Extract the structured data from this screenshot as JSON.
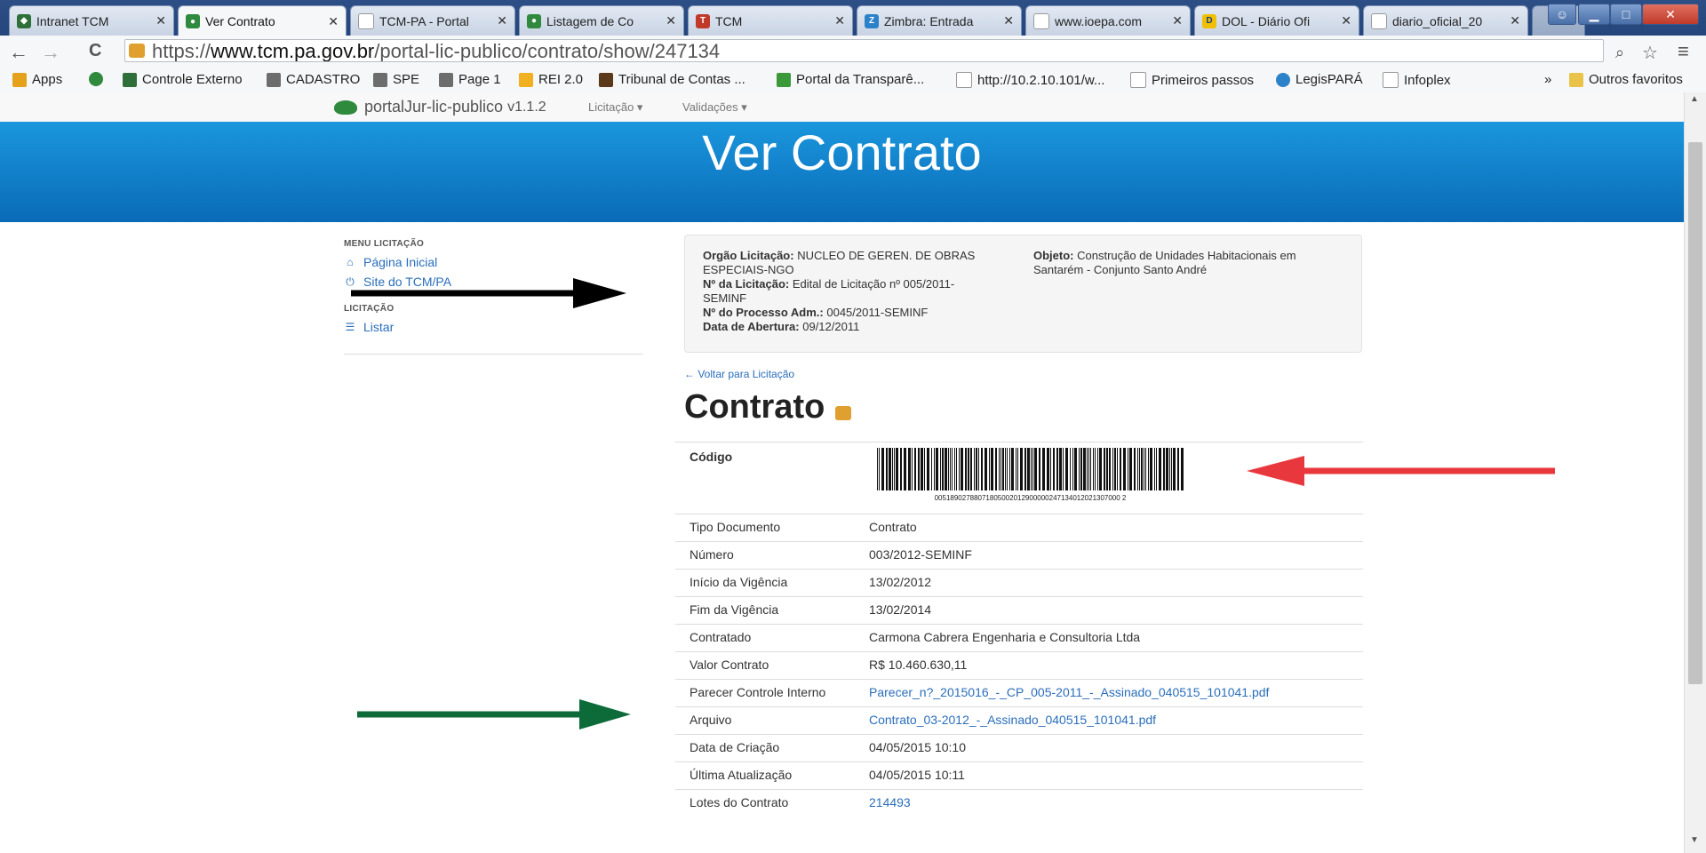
{
  "browser": {
    "tabs": [
      {
        "label": "Intranet TCM",
        "icon_color": "#2f6f3a"
      },
      {
        "label": "Ver Contrato",
        "icon_color": "#2f8a3e"
      },
      {
        "label": "TCM-PA - Portal",
        "icon_color": "#ffffff"
      },
      {
        "label": "Listagem de Co",
        "icon_color": "#2f8a3e"
      },
      {
        "label": "TCM",
        "icon_color": "#c0392b"
      },
      {
        "label": "Zimbra: Entrada",
        "icon_color": "#2c82c9"
      },
      {
        "label": "www.ioepa.com",
        "icon_color": "#ffffff"
      },
      {
        "label": "DOL - Diário Ofi",
        "icon_color": "#1a3c8c"
      },
      {
        "label": "diario_oficial_20",
        "icon_color": "#ffffff"
      }
    ],
    "url_scheme": "https://",
    "url_domain": "www.tcm.pa.gov.br",
    "url_path": "/portal-lic-publico/contrato/show/247134",
    "bookmarks": [
      {
        "label": "Apps",
        "color": "#e3a21a"
      },
      {
        "label": "",
        "color": "#2f8a3e"
      },
      {
        "label": "Controle Externo",
        "color": "#2f6f3a"
      },
      {
        "label": "CADASTRO",
        "color": "#6d6d6d"
      },
      {
        "label": "SPE",
        "color": "#6d6d6d"
      },
      {
        "label": "Page 1",
        "color": "#6d6d6d"
      },
      {
        "label": "REI 2.0",
        "color": "#f0b020"
      },
      {
        "label": "Tribunal de Contas ...",
        "color": "#5a3a1a"
      },
      {
        "label": "Portal da Transparê...",
        "color": "#3a9a3a"
      },
      {
        "label": "http://10.2.10.101/w...",
        "color": "#ffffff"
      },
      {
        "label": "Primeiros passos",
        "color": "#ffffff"
      },
      {
        "label": "LegisPARÁ",
        "color": "#2c82c9"
      },
      {
        "label": "Infoplex",
        "color": "#ffffff"
      }
    ],
    "other_bookmarks": "Outros favoritos",
    "chevron": "»"
  },
  "site": {
    "brand": "portalJur-lic-publico",
    "version": "v1.1.2",
    "menu": [
      "Licitação ▾",
      "Validações ▾"
    ],
    "hero_title": "Ver Contrato"
  },
  "sidebar": {
    "menu_heading": "MENU LICITAÇÃO",
    "home": "Página Inicial",
    "site": "Site do TCM/PA",
    "lic_heading": "LICITAÇÃO",
    "list": "Listar"
  },
  "licitacao": {
    "orgao_label": "Orgão Licitação:",
    "orgao_value_1": "NUCLEO DE GEREN. DE OBRAS",
    "orgao_value_2": "ESPECIAIS-NGO",
    "numero_label": "Nº da Licitação:",
    "numero_value_1": "Edital de Licitação nº 005/2011-",
    "numero_value_2": "SEMINF",
    "processo_label": "Nº do Processo Adm.:",
    "processo_value": "0045/2011-SEMINF",
    "abertura_label": "Data de Abertura:",
    "abertura_value": "09/12/2011",
    "objeto_label": "Objeto:",
    "objeto_value_1": "Construção de Unidades Habitacionais em",
    "objeto_value_2": "Santarém - Conjunto Santo André"
  },
  "back_link": "Voltar para Licitação",
  "contrato_title": "Contrato",
  "codigo": {
    "label": "Código",
    "barcode_number": "00518902788071805002012900000247134012021307000 2"
  },
  "rows": [
    {
      "key": "Tipo Documento",
      "value": "Contrato"
    },
    {
      "key": "Número",
      "value": "003/2012-SEMINF"
    },
    {
      "key": "Início da Vigência",
      "value": "13/02/2012"
    },
    {
      "key": "Fim da Vigência",
      "value": "13/02/2014"
    },
    {
      "key": "Contratado",
      "value": "Carmona Cabrera Engenharia e Consultoria Ltda"
    },
    {
      "key": "Valor Contrato",
      "value": "R$ 10.460.630,11"
    },
    {
      "key": "Parecer Controle Interno",
      "value": "Parecer_n?_2015016_-_CP_005-2011_-_Assinado_040515_101041.pdf"
    },
    {
      "key": "Arquivo",
      "value": "Contrato_03-2012_-_Assinado_040515_101041.pdf"
    },
    {
      "key": "Data de Criação",
      "value": "04/05/2015 10:10"
    },
    {
      "key": "Última Atualização",
      "value": "04/05/2015 10:11"
    },
    {
      "key": "Lotes do Contrato",
      "value": "214493"
    }
  ],
  "colors": {
    "hero": "#0a7cc8",
    "link": "#2a6ebb",
    "arrow_black": "#000000",
    "arrow_red": "#e8383d",
    "arrow_green": "#0d6b3a"
  }
}
